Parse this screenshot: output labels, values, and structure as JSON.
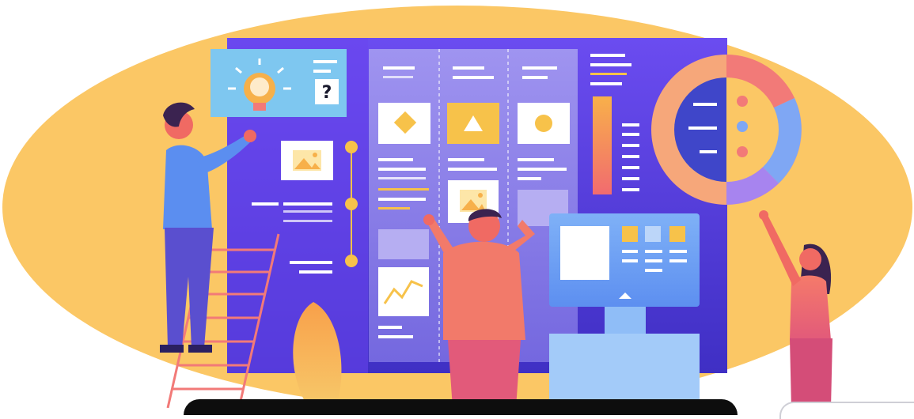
{
  "illustration": {
    "question_mark": "?",
    "colors": {
      "background_blob": "#fbc765",
      "board": "#5a3fe0",
      "board_dark": "#3f2fc4",
      "kanban_panel": "#8c7fe8",
      "accent_yellow": "#f7c24a",
      "accent_coral": "#f27a78",
      "skin_coral": "#f06a63",
      "shirt_blue": "#5b8ef0",
      "monitor_blue": "#7fb1f7"
    },
    "icons": [
      "lightbulb-icon",
      "image-icon",
      "diamond-icon",
      "triangle-icon",
      "circle-icon",
      "line-chart-icon",
      "donut-chart-icon",
      "play-triangle-icon"
    ]
  }
}
